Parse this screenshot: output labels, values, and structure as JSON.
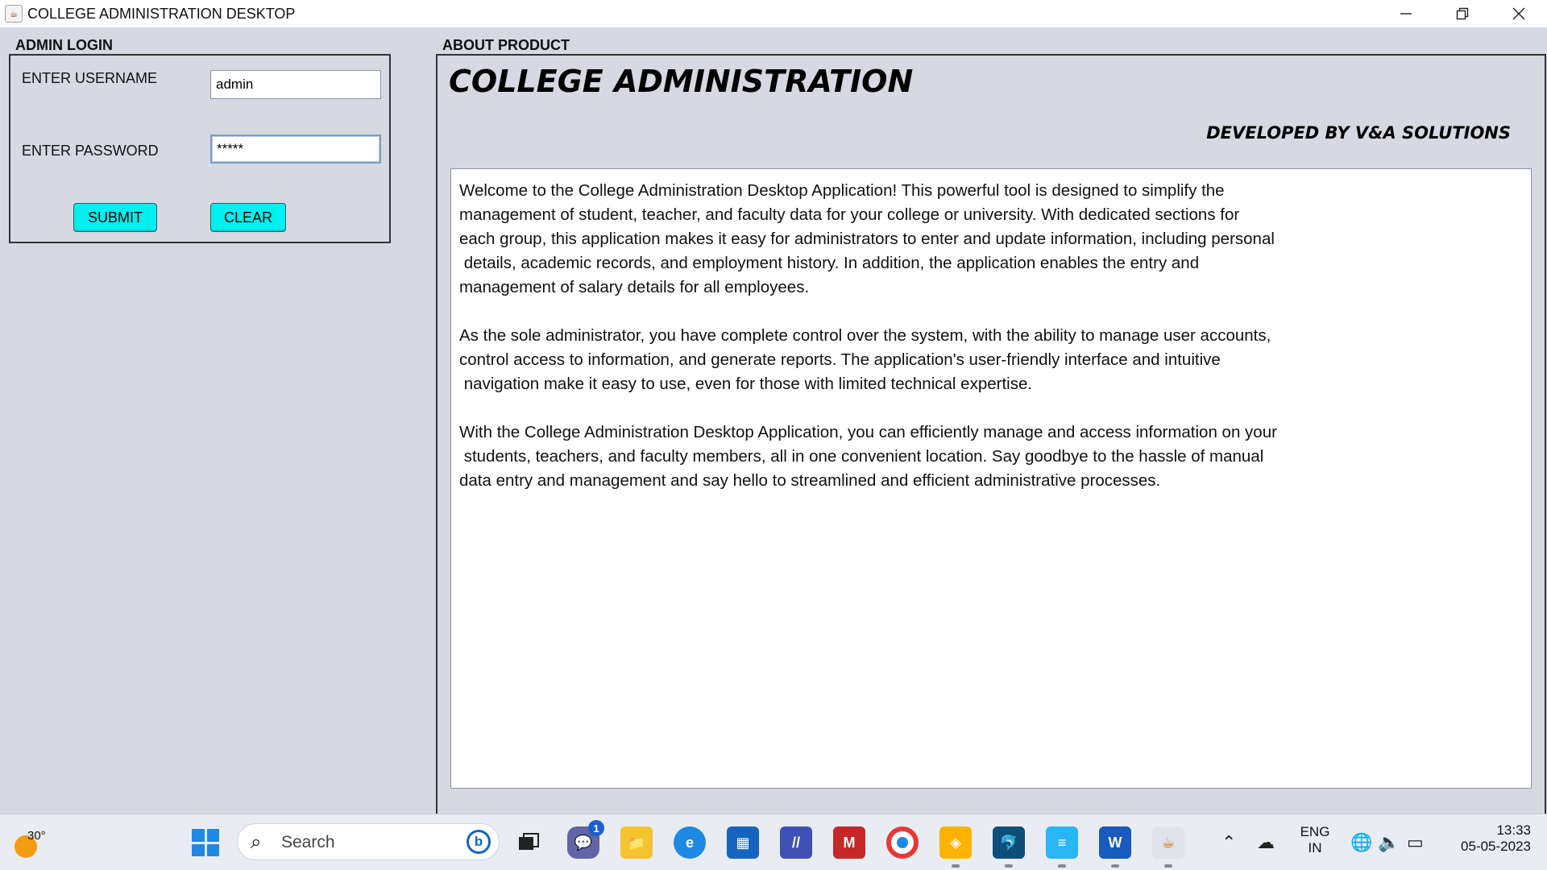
{
  "window": {
    "title": "COLLEGE ADMINISTRATION DESKTOP",
    "minimize_icon": "minimize-icon",
    "maximize_icon": "restore-icon",
    "close_icon": "close-icon"
  },
  "login": {
    "section_label": "ADMIN LOGIN",
    "username_label": "ENTER USERNAME",
    "username_value": "admin",
    "password_label": "ENTER PASSWORD",
    "password_value": "*****",
    "submit_label": "SUBMIT",
    "clear_label": "CLEAR"
  },
  "about": {
    "section_label": "ABOUT PRODUCT",
    "product_title": "COLLEGE ADMINISTRATION",
    "developed_by": "DEVELOPED BY V&A SOLUTIONS",
    "description": "Welcome to the College Administration Desktop Application! This powerful tool is designed to simplify the\nmanagement of student, teacher, and faculty data for your college or university. With dedicated sections for\neach group, this application makes it easy for administrators to enter and update information, including personal\n details, academic records, and employment history. In addition, the application enables the entry and\nmanagement of salary details for all employees.\n\nAs the sole administrator, you have complete control over the system, with the ability to manage user accounts,\ncontrol access to information, and generate reports. The application's user-friendly interface and intuitive\n navigation make it easy to use, even for those with limited technical expertise.\n\nWith the College Administration Desktop Application, you can efficiently manage and access information on your\n students, teachers, and faculty members, all in one convenient location. Say goodbye to the hassle of manual\ndata entry and management and say hello to streamlined and efficient administrative processes."
  },
  "taskbar": {
    "weather_temp": "30°",
    "search_placeholder": "Search",
    "chat_badge": "1",
    "lang_line1": "ENG",
    "lang_line2": "IN",
    "time": "13:33",
    "date": "05-05-2023"
  },
  "colors": {
    "button_bg": "#00f0f0",
    "panel_bg": "#d6d9e2"
  }
}
